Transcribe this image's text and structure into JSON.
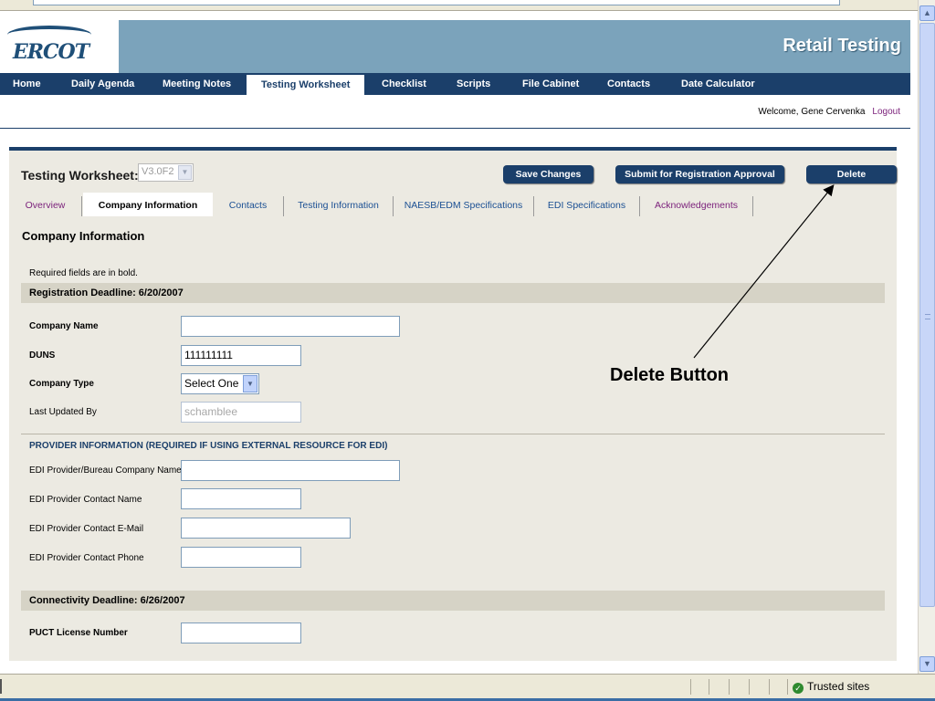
{
  "header": {
    "logo_text": "ERCOT",
    "banner_title": "Retail Testing"
  },
  "nav": {
    "items": [
      "Home",
      "Daily Agenda",
      "Meeting Notes",
      "Testing Worksheet",
      "Checklist",
      "Scripts",
      "File Cabinet",
      "Contacts",
      "Date Calculator"
    ],
    "active": "Testing Worksheet"
  },
  "user": {
    "welcome": "Welcome, Gene Cervenka",
    "logout": "Logout"
  },
  "worksheet": {
    "label": "Testing Worksheet:",
    "version": "V3.0F2",
    "buttons": {
      "save": "Save Changes",
      "submit": "Submit for Registration Approval",
      "delete": "Delete"
    },
    "tabs": [
      "Overview",
      "Company Information",
      "Contacts",
      "Testing Information",
      "NAESB/EDM Specifications",
      "EDI Specifications",
      "Acknowledgements"
    ],
    "active_tab": "Company Information"
  },
  "company_info": {
    "title": "Company Information",
    "required_note": "Required fields are in bold.",
    "registration_deadline": "Registration Deadline: 6/20/2007",
    "fields": {
      "company_name": {
        "label": "Company Name",
        "value": ""
      },
      "duns": {
        "label": "DUNS",
        "value": "111111111"
      },
      "company_type": {
        "label": "Company Type",
        "value": "Select One"
      },
      "last_updated_by": {
        "label": "Last Updated By",
        "value": "schamblee"
      }
    },
    "provider_heading": "PROVIDER INFORMATION (REQUIRED IF USING EXTERNAL RESOURCE FOR EDI)",
    "provider_fields": {
      "bureau_company": {
        "label": "EDI Provider/Bureau Company Name",
        "value": ""
      },
      "contact_name": {
        "label": "EDI Provider Contact Name",
        "value": ""
      },
      "contact_email": {
        "label": "EDI Provider Contact E-Mail",
        "value": ""
      },
      "contact_phone": {
        "label": "EDI Provider Contact Phone",
        "value": ""
      }
    },
    "connectivity_deadline": "Connectivity Deadline: 6/26/2007",
    "puct": {
      "label": "PUCT License Number",
      "value": ""
    }
  },
  "annotation": {
    "text": "Delete Button"
  },
  "status_bar": {
    "zone": "Trusted sites"
  },
  "colors": {
    "nav_bg": "#1b3f6a",
    "banner_bg": "#7ba3bb",
    "panel_bg": "#eceae2",
    "band_bg": "#d6d3c6",
    "tab_link": "#1a4f93",
    "visited_link": "#7a1f7a"
  }
}
